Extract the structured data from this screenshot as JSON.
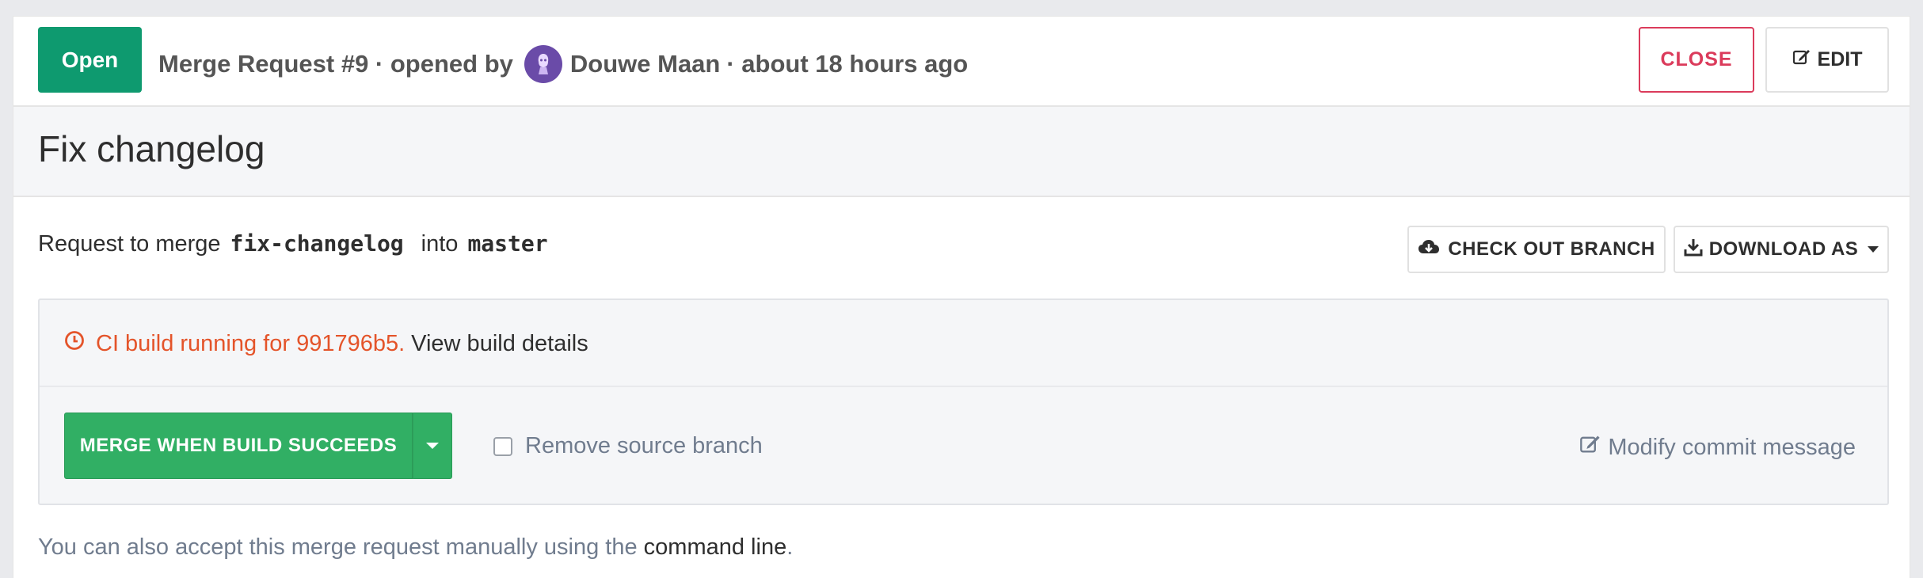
{
  "header": {
    "status": "Open",
    "meta_prefix": "Merge Request #9 · opened by",
    "author": "Douwe Maan",
    "meta_time": "· about 18 hours ago",
    "close_label": "CLOSE",
    "edit_label": "EDIT"
  },
  "title": "Fix changelog",
  "request": {
    "prefix": "Request to merge",
    "source_branch": "fix-changelog",
    "into": "into",
    "target_branch": "master",
    "checkout_label": "CHECK OUT BRANCH",
    "download_label": "DOWNLOAD AS"
  },
  "widget": {
    "ci_text": "CI build running for 991796b5.",
    "ci_link": "View build details",
    "merge_label": "MERGE WHEN BUILD SUCCEEDS",
    "remove_source_label": "Remove source branch",
    "modify_commit_label": "Modify commit message"
  },
  "footer": {
    "manual_text": "You can also accept this merge request manually using the",
    "command_line_link": "command line",
    "period": "."
  },
  "colors": {
    "open_badge": "#0e9a6f",
    "close_red": "#db3b5b",
    "merge_green": "#31af64",
    "ci_running": "#e4542a"
  },
  "icons": {
    "edit": "edit-icon",
    "cloud_download": "cloud-download-icon",
    "download": "download-icon",
    "clock": "clock-icon",
    "caret": "caret-down-icon"
  }
}
